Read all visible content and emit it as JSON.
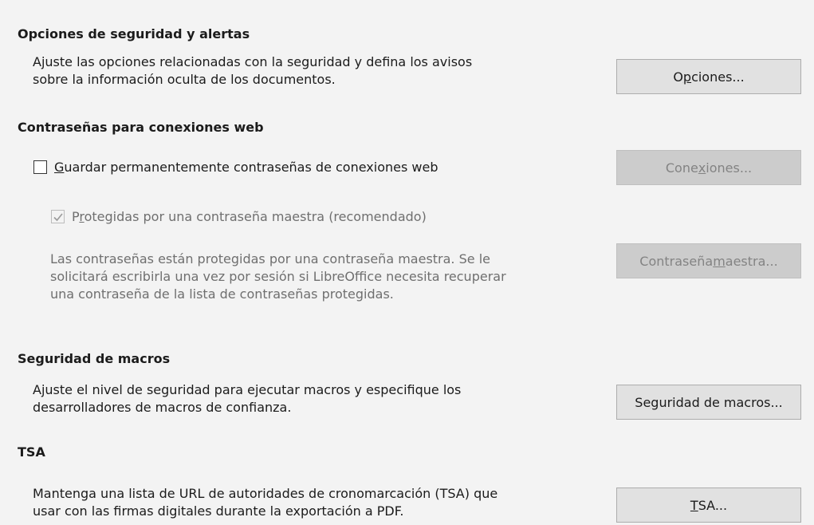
{
  "security_options": {
    "heading": "Opciones de seguridad y alertas",
    "desc_lines": [
      "Ajuste las opciones relacionadas con la seguridad y defina los avisos",
      "sobre la información oculta de los documentos."
    ],
    "button": {
      "pre": "O",
      "mn": "p",
      "post": "ciones..."
    }
  },
  "web_passwords": {
    "heading": "Contraseñas para conexiones web",
    "persist_checkbox": {
      "checked": false,
      "pre": "",
      "mn": "G",
      "post": "uardar permanentemente contraseñas de conexiones web"
    },
    "connections_button": {
      "pre": "Cone",
      "mn": "x",
      "post": "iones...",
      "disabled": true
    },
    "master_checkbox": {
      "checked": true,
      "disabled": true,
      "pre": "P",
      "mn": "r",
      "post": "otegidas por una contraseña maestra (recomendado)"
    },
    "desc_lines": [
      "Las contraseñas están protegidas por una contraseña maestra. Se le",
      "solicitará escribirla una vez por sesión si LibreOffice necesita recuperar",
      "una contraseña de la lista de contraseñas protegidas."
    ],
    "master_button": {
      "pre": "Contraseña ",
      "mn": "m",
      "post": "aestra...",
      "disabled": true
    }
  },
  "macro_security": {
    "heading": "Seguridad de macros",
    "desc_lines": [
      "Ajuste el nivel de seguridad para ejecutar macros y especifique los",
      "desarrolladores de macros de confianza."
    ],
    "button": {
      "pre": "Se",
      "mn": "g",
      "post": "uridad de macros..."
    }
  },
  "tsa": {
    "heading": "TSA",
    "desc_lines": [
      "Mantenga una lista de URL de autoridades de cronomarcación (TSA) que",
      "usar con las firmas digitales durante la exportación a PDF."
    ],
    "button": {
      "pre": "",
      "mn": "T",
      "post": "SA..."
    }
  },
  "icons": {
    "checkmark": "checkmark-icon"
  }
}
